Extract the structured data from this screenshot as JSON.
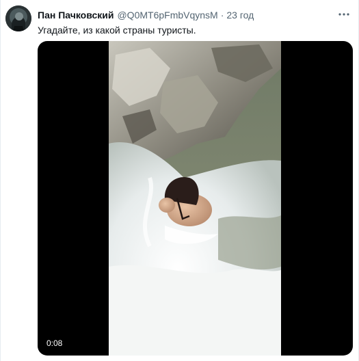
{
  "tweet": {
    "display_name": "Пан Пачковский",
    "handle": "@Q0MT6pFmbVqynsM",
    "separator": "·",
    "time": "23 год",
    "text": "Угадайте, из какой страны туристы."
  },
  "media": {
    "video_time": "0:08",
    "type": "video"
  },
  "colors": {
    "name": "#0f1419",
    "secondary": "#536471",
    "media_background": "#000000"
  },
  "icons": {
    "more": "more-horizontal-icon",
    "avatar": "avatar-image"
  }
}
